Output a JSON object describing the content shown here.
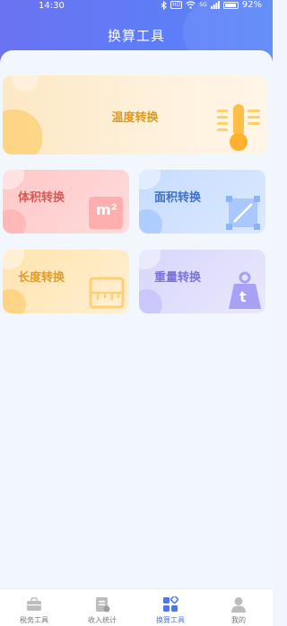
{
  "status_bar": {
    "time": "14:30",
    "battery": "92%",
    "network_badge": "HD",
    "signal": "5G"
  },
  "header": {
    "title": "换算工具"
  },
  "cards": {
    "temperature": {
      "label": "温度转换",
      "icon": "thermometer-icon"
    },
    "volume": {
      "label": "体积转换",
      "icon": "cube-m2-icon",
      "icon_text": "m²"
    },
    "area": {
      "label": "面积转换",
      "icon": "area-square-icon"
    },
    "length": {
      "label": "长度转换",
      "icon": "ruler-icon"
    },
    "weight": {
      "label": "重量转换",
      "icon": "weight-icon",
      "icon_text": "t"
    }
  },
  "tabbar": {
    "items": [
      {
        "label": "税务工具",
        "icon": "briefcase-icon",
        "active": false
      },
      {
        "label": "收入统计",
        "icon": "document-icon",
        "active": false
      },
      {
        "label": "换算工具",
        "icon": "grid-icon",
        "active": true
      },
      {
        "label": "我的",
        "icon": "person-icon",
        "active": false
      }
    ]
  },
  "colors": {
    "accent": "#4e78e6",
    "header_start": "#6b73f2",
    "header_end": "#5a86f8"
  }
}
